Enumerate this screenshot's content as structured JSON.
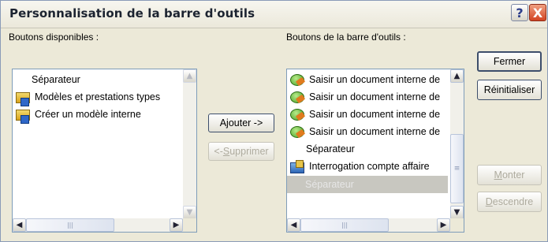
{
  "window": {
    "title": "Personnalisation de la barre d'outils",
    "help_label": "?",
    "close_label": "X"
  },
  "available": {
    "label": "Boutons disponibles :",
    "items": [
      {
        "text": "Séparateur",
        "icon": ""
      },
      {
        "text": "Modèles et prestations types",
        "icon": "document-folder-icon"
      },
      {
        "text": "Créer un modèle interne",
        "icon": "document-folder-icon"
      }
    ]
  },
  "toolbar": {
    "label": "Boutons de la barre d'outils :",
    "items": [
      {
        "text": "Saisir un document interne de",
        "icon": "green-document-icon"
      },
      {
        "text": "Saisir un document interne de",
        "icon": "green-document-icon"
      },
      {
        "text": "Saisir un document interne de",
        "icon": "green-document-icon"
      },
      {
        "text": "Saisir un document interne de",
        "icon": "green-document-icon"
      },
      {
        "text": "Séparateur",
        "icon": ""
      },
      {
        "text": "Interrogation compte affaire",
        "icon": "folder-search-icon"
      },
      {
        "text": "Séparateur",
        "icon": "",
        "selected": true
      }
    ]
  },
  "buttons": {
    "add": "Ajouter ->",
    "remove_prefix": "<- ",
    "remove_mnemonic": "S",
    "remove_rest": "upprimer",
    "close": "Fermer",
    "reset": "Réinitialiser",
    "up_mnemonic": "M",
    "up_rest": "onter",
    "down_mnemonic": "D",
    "down_rest": "escendre"
  },
  "scroll": {
    "up_arrow": "▲",
    "down_arrow": "▼",
    "left_arrow": "◀",
    "right_arrow": "▶",
    "grip": "|||",
    "hgrip": "≡"
  },
  "colors": {
    "title_close": "#d24423",
    "selection": "#c8c7c0",
    "window_bg": "#ece9d8"
  }
}
